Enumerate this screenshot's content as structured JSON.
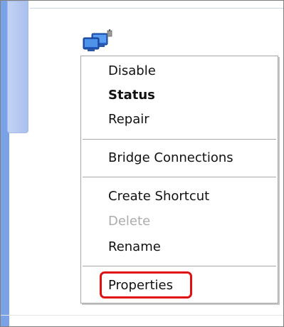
{
  "context_menu": {
    "items": [
      {
        "label": "Disable",
        "style": "normal"
      },
      {
        "label": "Status",
        "style": "bold"
      },
      {
        "label": "Repair",
        "style": "normal"
      },
      {
        "label": "Bridge Connections",
        "style": "normal"
      },
      {
        "label": "Create Shortcut",
        "style": "normal"
      },
      {
        "label": "Delete",
        "style": "disabled"
      },
      {
        "label": "Rename",
        "style": "normal"
      },
      {
        "label": "Properties",
        "style": "normal"
      }
    ],
    "highlighted_item": "Properties",
    "highlight_color": "#e01010"
  },
  "icons": {
    "network_connection": "network-connection-icon"
  },
  "colors": {
    "pane_accent": "#7aa2e6",
    "scrollbar": "#b7caf1"
  }
}
